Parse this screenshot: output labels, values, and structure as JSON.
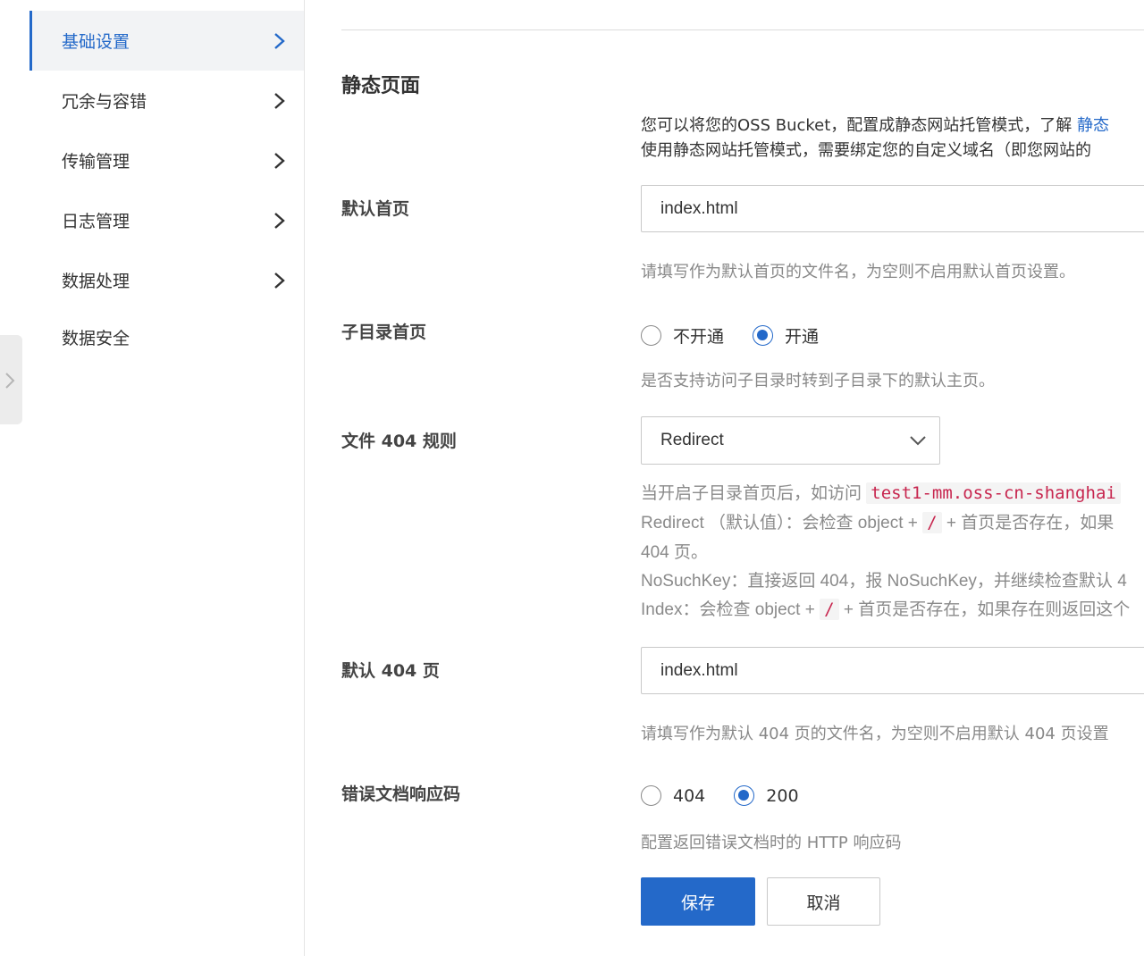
{
  "sidebar": {
    "items": [
      {
        "label": "基础设置",
        "active": true,
        "has_chevron": true
      },
      {
        "label": "冗余与容错",
        "active": false,
        "has_chevron": true
      },
      {
        "label": "传输管理",
        "active": false,
        "has_chevron": true
      },
      {
        "label": "日志管理",
        "active": false,
        "has_chevron": true
      },
      {
        "label": "数据处理",
        "active": false,
        "has_chevron": true
      },
      {
        "label": "数据安全",
        "active": false,
        "has_chevron": false
      }
    ]
  },
  "section": {
    "title": "静态页面",
    "desc_line1_prefix": "您可以将您的OSS Bucket，配置成静态网站托管模式，了解 ",
    "desc_line1_link": "静态",
    "desc_line2": "使用静态网站托管模式，需要绑定您的自定义域名（即您网站的"
  },
  "fields": {
    "default_index": {
      "label": "默认首页",
      "value": "index.html",
      "help": "请填写作为默认首页的文件名，为空则不启用默认首页设置。"
    },
    "subdir_index": {
      "label": "子目录首页",
      "options": [
        "不开通",
        "开通"
      ],
      "selected": "开通",
      "help": "是否支持访问子目录时转到子目录下的默认主页。"
    },
    "file_404_rule": {
      "label": "文件 404 规则",
      "selected": "Redirect",
      "help_line1_prefix": "当开启子目录首页后，如访问 ",
      "help_line1_code": "test1-mm.oss-cn-shanghai",
      "help_line2_prefix": "Redirect （默认值）：会检查 object + ",
      "help_line2_code": "/",
      "help_line2_suffix": " + 首页是否存在，如果",
      "help_line3": "404 页。",
      "help_line4": "NoSuchKey：直接返回 404，报 NoSuchKey，并继续检查默认 4",
      "help_line5_prefix": "Index：会检查 object + ",
      "help_line5_code": "/",
      "help_line5_suffix": " + 首页是否存在，如果存在则返回这个"
    },
    "default_404": {
      "label": "默认 404 页",
      "value": "index.html",
      "help": "请填写作为默认 404 页的文件名，为空则不启用默认 404 页设置"
    },
    "error_code": {
      "label": "错误文档响应码",
      "options": [
        "404",
        "200"
      ],
      "selected": "200",
      "help": "配置返回错误文档时的 HTTP 响应码"
    }
  },
  "buttons": {
    "save": "保存",
    "cancel": "取消"
  },
  "colors": {
    "accent": "#2469c9",
    "code_text": "#c7254e"
  }
}
